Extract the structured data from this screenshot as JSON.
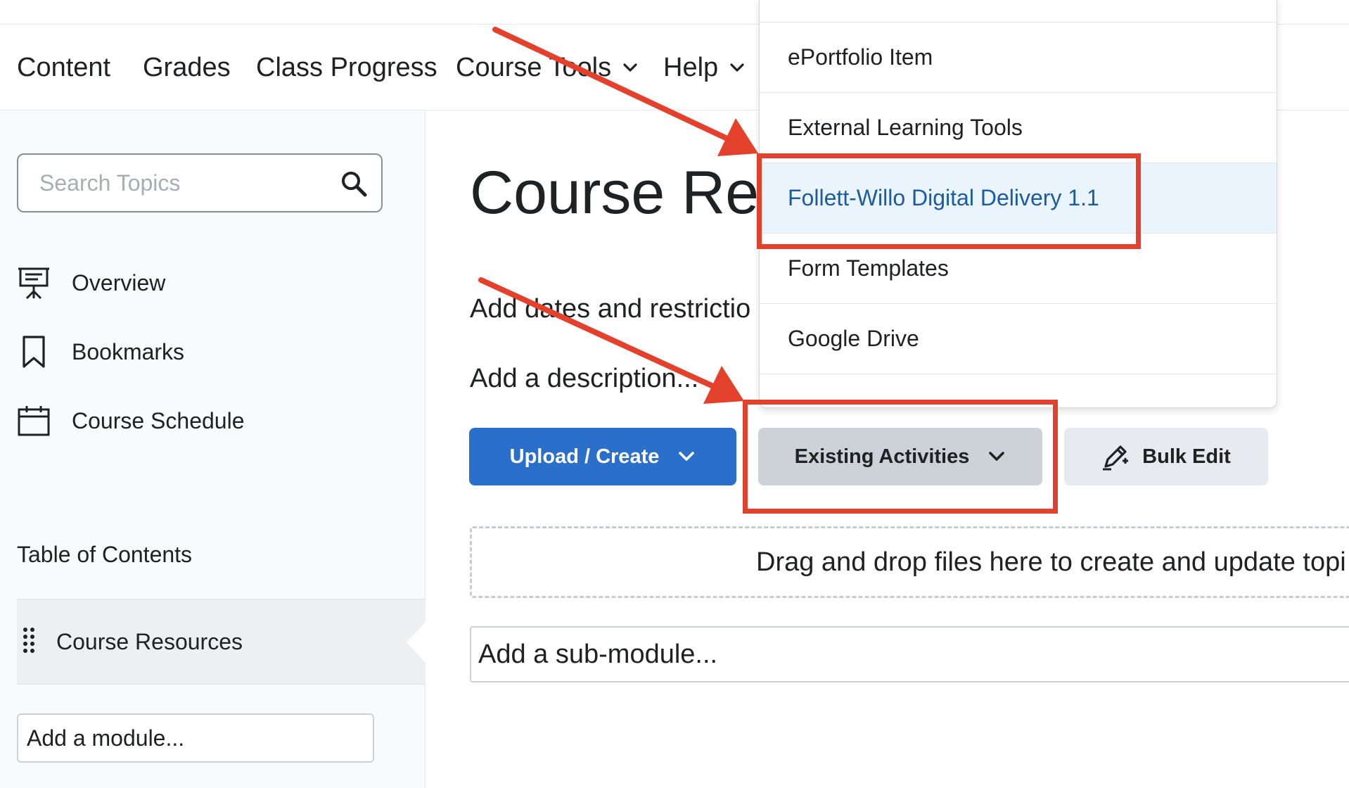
{
  "nav": {
    "items": [
      "Content",
      "Grades",
      "Class Progress",
      "Course Tools",
      "Help"
    ]
  },
  "sidebar": {
    "search_placeholder": "Search Topics",
    "links": [
      "Overview",
      "Bookmarks",
      "Course Schedule"
    ],
    "toc_title": "Table of Contents",
    "selected_module": "Course Resources",
    "add_module": "Add a module..."
  },
  "main": {
    "title": "Course Reso",
    "dates_link": "Add dates and restrictio",
    "description_link": "Add a description...",
    "buttons": {
      "upload_create": "Upload / Create",
      "existing_activities": "Existing Activities",
      "bulk_edit": "Bulk Edit"
    },
    "dropzone_text": "Drag and drop files here to create and update topi",
    "submodule_text": "Add a sub-module..."
  },
  "dropdown": {
    "items": [
      "ePortfolio Item",
      "External Learning Tools",
      "Follett-Willo Digital Delivery 1.1",
      "Form Templates",
      "Google Drive"
    ],
    "highlighted": "Follett-Willo Digital Delivery 1.1"
  },
  "colors": {
    "primary": "#2a6fc9",
    "annotation": "#e3412b",
    "highlight_bg": "#eaf4fc",
    "highlight_text": "#1d5a9f"
  },
  "icons": {
    "search": "search-icon",
    "overview": "presentation-icon",
    "bookmarks": "bookmark-icon",
    "schedule": "calendar-icon",
    "drag": "drag-handle-icon",
    "chevron": "chevron-down-icon",
    "bulk_edit": "pencil-icon"
  }
}
